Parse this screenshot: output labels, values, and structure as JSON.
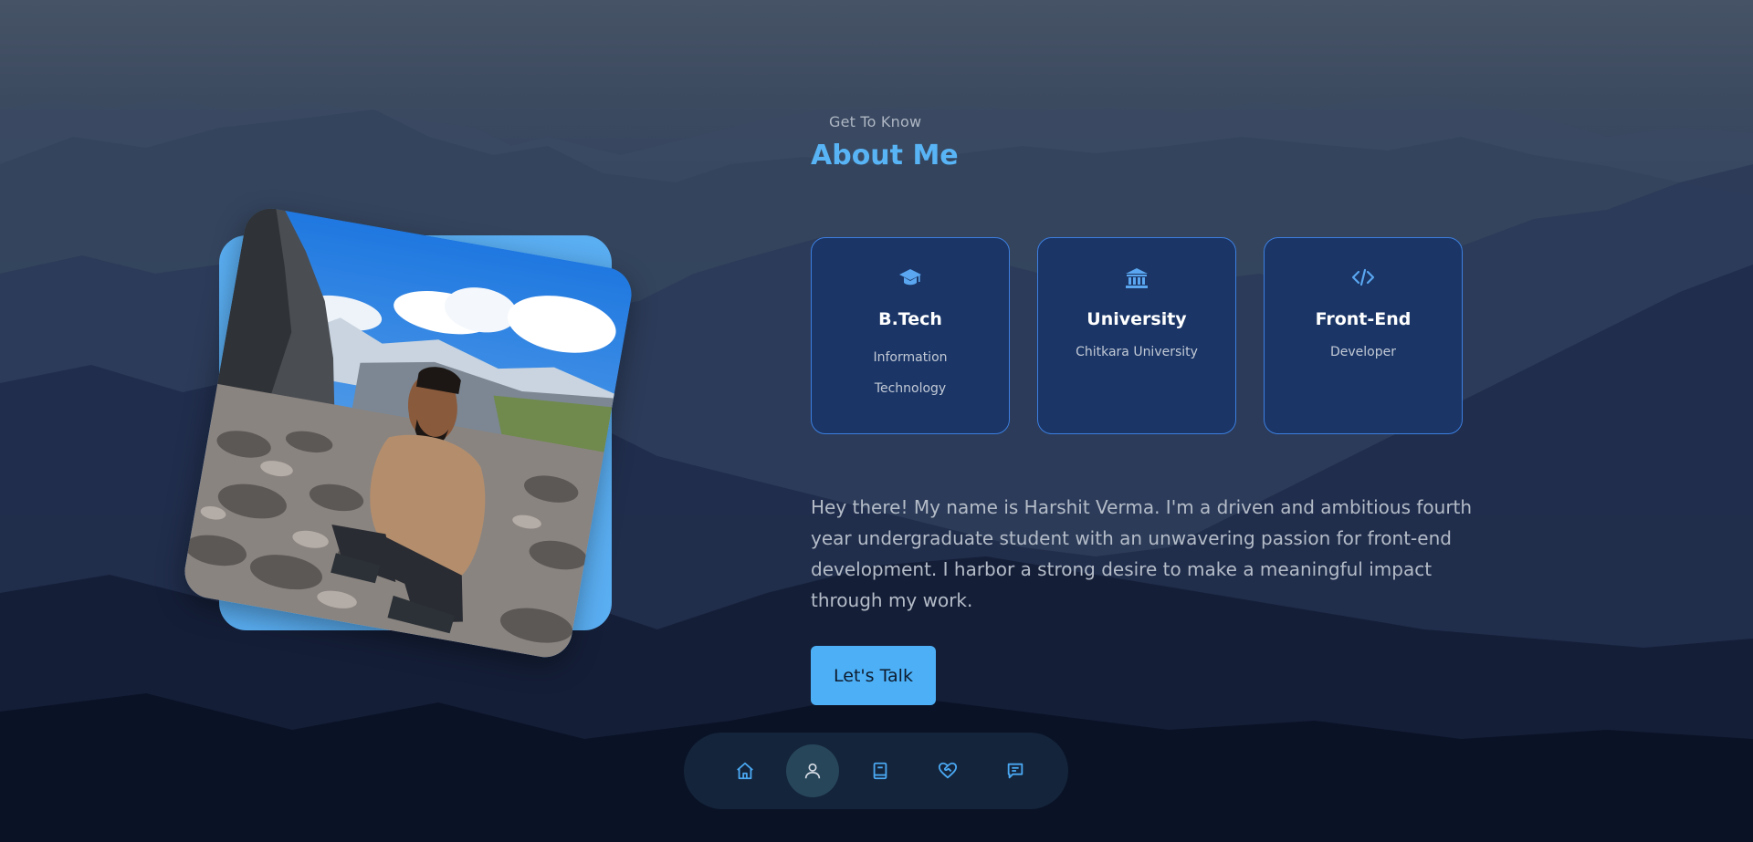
{
  "header": {
    "eyebrow": "Get To Know",
    "title": "About Me"
  },
  "cards": [
    {
      "icon": "graduation-cap-icon",
      "title": "B.Tech",
      "subtitle": "Information Technology"
    },
    {
      "icon": "university-building-icon",
      "title": "University",
      "subtitle": "Chitkara University"
    },
    {
      "icon": "code-icon",
      "title": "Front-End",
      "subtitle": "Developer"
    }
  ],
  "about_text": "Hey there! My name is Harshit Verma. I'm a driven and ambitious fourth year undergraduate student with an unwavering passion for front-end development. I harbor a strong desire to make a meaningful impact through my work.",
  "cta": {
    "label": "Let's Talk"
  },
  "nav": {
    "items": [
      {
        "icon": "home-icon",
        "active": false
      },
      {
        "icon": "user-icon",
        "active": true
      },
      {
        "icon": "book-icon",
        "active": false
      },
      {
        "icon": "heart-handshake-icon",
        "active": false
      },
      {
        "icon": "message-icon",
        "active": false
      }
    ]
  },
  "colors": {
    "accent": "#4db0f7",
    "title": "#58b4f5",
    "card_bg": "#1a3566",
    "card_border": "#3d7fe0",
    "nav_bg": "#16283e"
  }
}
